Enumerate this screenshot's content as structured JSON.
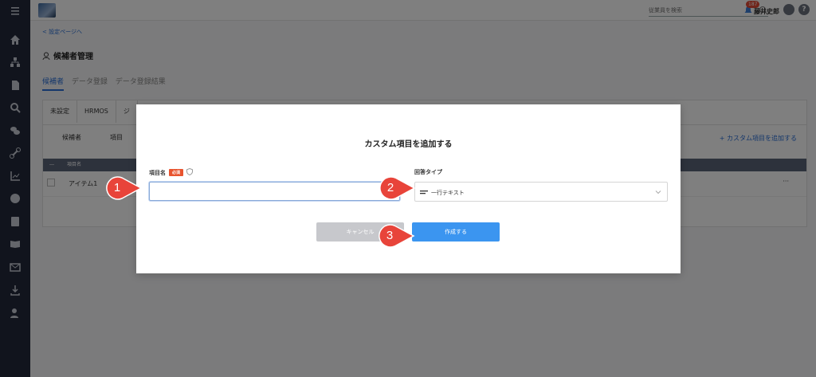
{
  "topbar": {
    "search_placeholder": "従業員を検索",
    "notification_count": "187",
    "user_name": "藤井史郎",
    "help_label": "?"
  },
  "page": {
    "back_link": "< 設定ページへ",
    "title": "候補者管理",
    "tabs": [
      "候補者",
      "データ登録",
      "データ登録結果"
    ],
    "subtabs": [
      "未設定",
      "HRMOS",
      "ジ"
    ],
    "view_tabs": [
      "候補者",
      "項目"
    ],
    "add_custom_link": "+ カスタム項目を追加する",
    "table_header": [
      "―",
      "項目名"
    ],
    "row_item": "アイテム1",
    "row_menu": "···"
  },
  "modal": {
    "title": "カスタム項目を追加する",
    "field_name_label": "項目名",
    "required_badge": "必須",
    "field_name_value": "",
    "field_type_label": "回答タイプ",
    "field_type_value": "一行テキスト",
    "cancel_label": "キャンセル",
    "create_label": "作成する"
  },
  "callouts": [
    "1",
    "2",
    "3"
  ],
  "colors": {
    "accent": "#3b95f0",
    "sidebar": "#22293a",
    "callout": "#e8443a",
    "required": "#e8532e"
  }
}
